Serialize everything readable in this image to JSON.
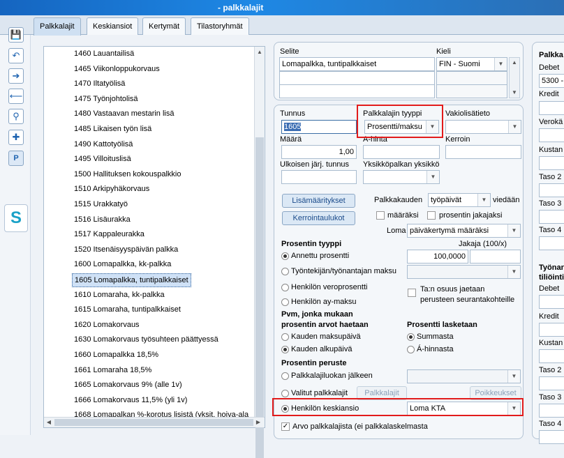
{
  "window": {
    "title": "- palkkalajit"
  },
  "tabs": [
    "Palkkalajit",
    "Keskiansiot",
    "Kertymät",
    "Tilastoryhmät"
  ],
  "toolbar": {
    "p_label": "P"
  },
  "list": [
    "1460 Lauantailisä",
    "1465 Viikonloppukorvaus",
    "1470 Iltatyölisä",
    "1475 Työnjohtolisä",
    "1480 Vastaavan mestarin lisä",
    "1485 Likaisen työn lisä",
    "1490 Kattotyölisä",
    "1495 Villoituslisä",
    "1500 Hallituksen kokouspalkkio",
    "1510 Arkipyhäkorvaus",
    "1515 Urakkatyö",
    "1516 Lisäurakka",
    "1517 Kappaleurakka",
    "1520 Itsenäisyyspäivän palkka",
    "1600 Lomapalkka, kk-palkka",
    "1605 Lomapalkka, tuntipalkkaiset",
    "1610 Lomaraha, kk-palkka",
    "1615 Lomaraha, tuntipalkkaiset",
    "1620 Lomakorvaus",
    "1630 Lomakorvaus työsuhteen päättyessä",
    "1660 Lomapalkka 18,5%",
    "1661 Lomaraha 18,5%",
    "1665 Lomakorvaus 9% (alle 1v)",
    "1666 Lomakorvaus 11,5% (yli 1v)",
    "1668 Lomapalkan %-korotus lisistä (yksit. hoiva-ala"
  ],
  "selected_index": 15,
  "desc": {
    "selite_label": "Selite",
    "kieli_label": "Kieli",
    "selite_value": "Lomapalkka, tuntipalkkaiset",
    "kieli_value": "FIN - Suomi"
  },
  "form": {
    "tunnus_label": "Tunnus",
    "tunnus_value": "1605",
    "tyyppi_label": "Palkkalajin tyyppi",
    "tyyppi_value": "Prosentti/maksu",
    "vakio_label": "Vakiolisätieto",
    "maara_label": "Määrä",
    "maara_value": "1,00",
    "ahinta_label": "A-hinta",
    "kerroin_label": "Kerroin",
    "ulkoinen_label": "Ulkoisen järj. tunnus",
    "yksikko_label": "Yksikköpalkan yksikkö",
    "lisamaaritykset_btn": "Lisämääritykset",
    "kerrointaulukot_btn": "Kerrointaulukot",
    "palkkakauden_label": "Palkkakauden",
    "palkkakauden_value": "työpäivät",
    "viedaan_label": "viedään",
    "maaraksi_label": "määräksi",
    "jakajaksi_label": "prosentin jakajaksi",
    "loma_label": "Loma",
    "loma_value": "päiväkertymä määräksi",
    "prosentin_tyyppi_label": "Prosentin tyyppi",
    "jakaja_label": "Jakaja (100/x)",
    "annettu_label": "Annettu prosentti",
    "annettu_value": "100,0000",
    "tyontekijan_label": "Työntekijän/työnantajan maksu",
    "veroprosentti_label": "Henkilön veroprosentti",
    "taon_osuus_label": "Ta:n osuus jaetaan",
    "perusteen_label": "perusteen seurantakohteille",
    "aymaksu_label": "Henkilön ay-maksu",
    "pvm_label": "Pvm, jonka mukaan",
    "prosentin_arvot_label": "prosentin arvot haetaan",
    "lasketaan_label": "Prosentti lasketaan",
    "maksupaiva_label": "Kauden maksupäivä",
    "summasta_label": "Summasta",
    "alkupaiva_label": "Kauden alkupäivä",
    "ahinnasta_label": "Á-hinnasta",
    "peruste_label": "Prosentin peruste",
    "palkkaluokan_label": "Palkkalajiluokan jälkeen",
    "valitut_label": "Valitut palkkalajit",
    "palkkalajit_btn": "Palkkalajit",
    "poikkeukset_btn": "Poikkeukset",
    "keskiansio_label": "Henkilön keskiansio",
    "keskiansio_value": "Loma KTA",
    "arvo_label": "Arvo palkkalajista (ei palkkalaskelmasta"
  },
  "right": {
    "palkka_label": "Palkka",
    "debet_label": "Debet",
    "debet_value": "5300 -",
    "kredit_label": "Kredit",
    "veroka_label": "Verokä",
    "kustan_label": "Kustan",
    "taso2_label": "Taso 2",
    "taso3_label": "Taso 3",
    "taso4_label": "Taso 4",
    "tyonan_label": "Työnan",
    "tiliointi_label": "tiliöinti",
    "debet2_label": "Debet",
    "kredit2_label": "Kredit",
    "kustan2_label": "Kustan",
    "taso2b_label": "Taso 2",
    "taso3b_label": "Taso 3",
    "taso4b_label": "Taso 4"
  },
  "colors": {
    "accent": "#1e88e5",
    "highlight": "#e21b1b",
    "selected_row": "#cfe1f6"
  }
}
